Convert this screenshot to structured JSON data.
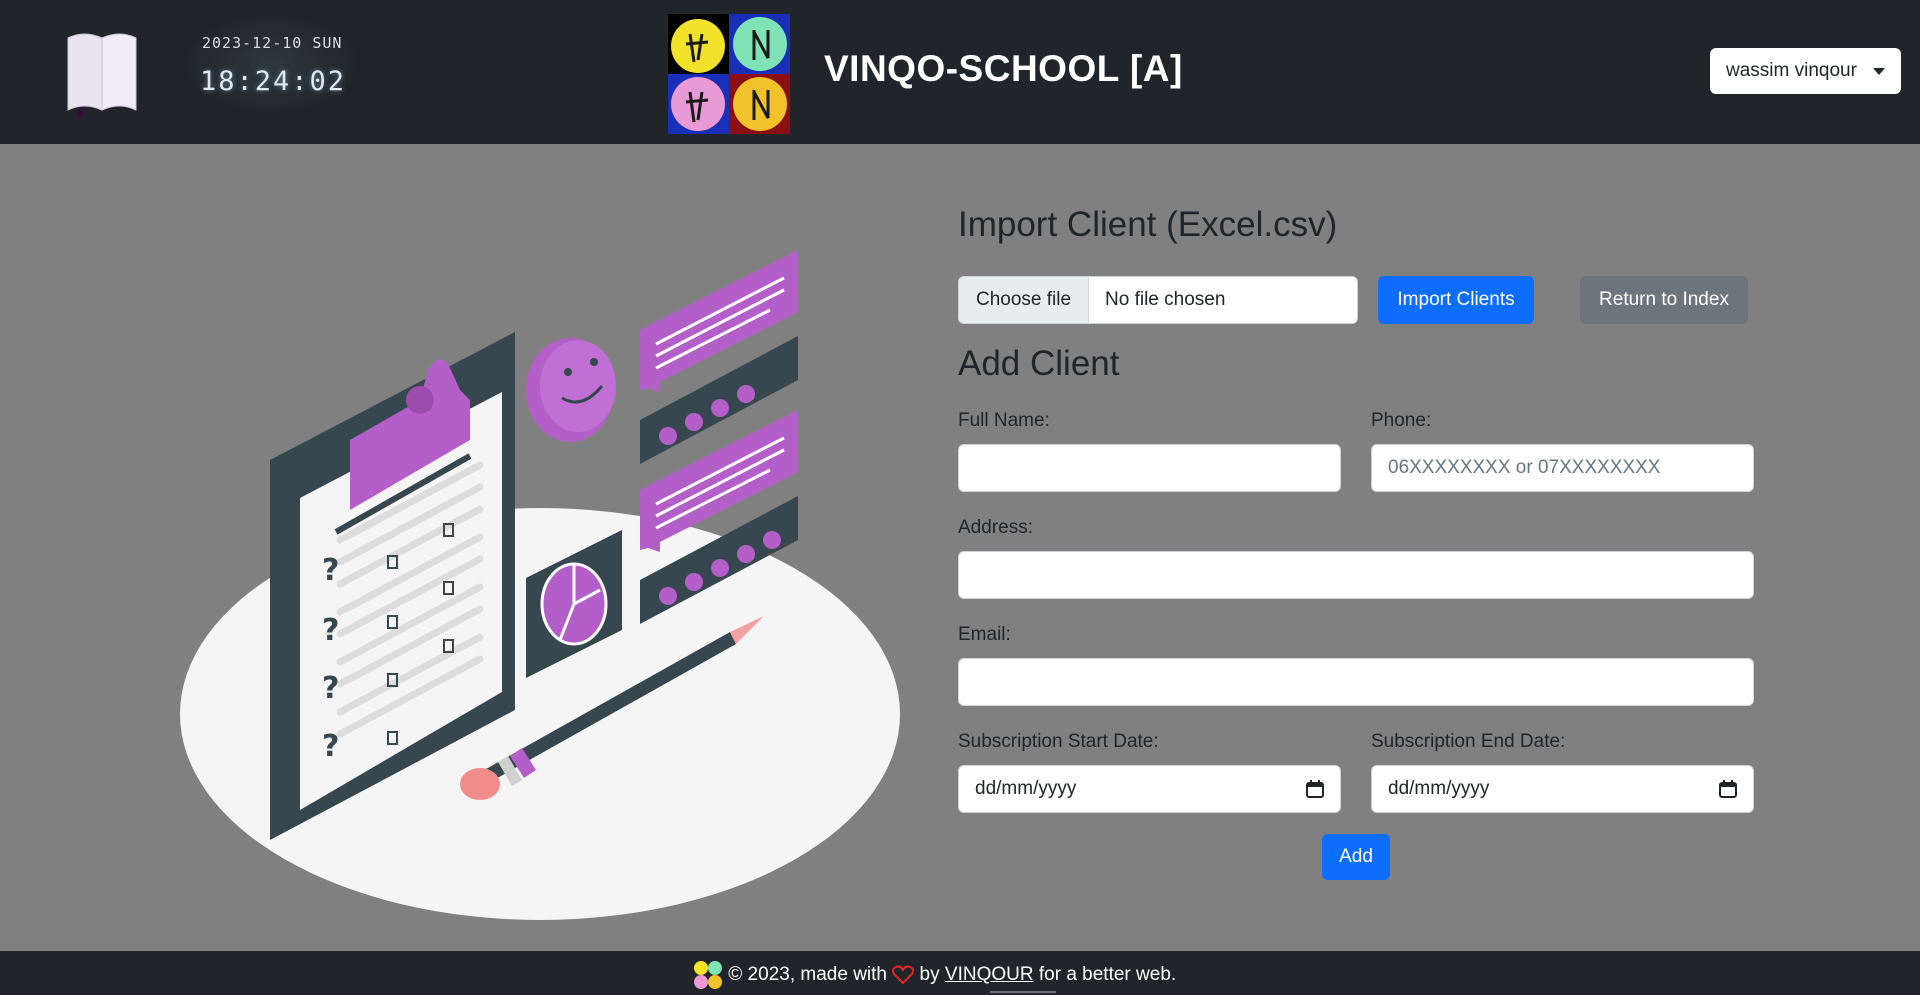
{
  "header": {
    "clock_date": "2023-12-10 SUN",
    "clock_time": "18:24:02",
    "app_title": "VINQO-SCHOOL [A]",
    "user_name": "wassim vinqour"
  },
  "import_section": {
    "title": "Import Client (Excel.csv)",
    "choose_file_label": "Choose file",
    "file_status": "No file chosen",
    "import_button": "Import Clients",
    "return_button": "Return to Index"
  },
  "add_section": {
    "title": "Add Client",
    "full_name_label": "Full Name:",
    "full_name_value": "",
    "phone_label": "Phone:",
    "phone_placeholder": "06XXXXXXXX or 07XXXXXXXX",
    "address_label": "Address:",
    "address_value": "",
    "email_label": "Email:",
    "email_value": "",
    "start_date_label": "Subscription Start Date:",
    "start_date_placeholder": "dd/mm/yyyy",
    "end_date_label": "Subscription End Date:",
    "end_date_placeholder": "dd/mm/yyyy",
    "add_button": "Add"
  },
  "footer": {
    "prefix": "© 2023, made with",
    "by": "by",
    "author": "VINQOUR",
    "suffix": "for a better web."
  },
  "colors": {
    "header_bg": "#212529",
    "page_bg": "#808080",
    "primary": "#0d6efd",
    "secondary": "#6c757d",
    "accent_purple": "#b45fc9",
    "heart": "#e0262b"
  },
  "icons": {
    "book": "book-icon",
    "logo": "school-logo",
    "caret": "caret-down-icon",
    "calendar": "calendar-icon",
    "heart": "heart-icon"
  }
}
